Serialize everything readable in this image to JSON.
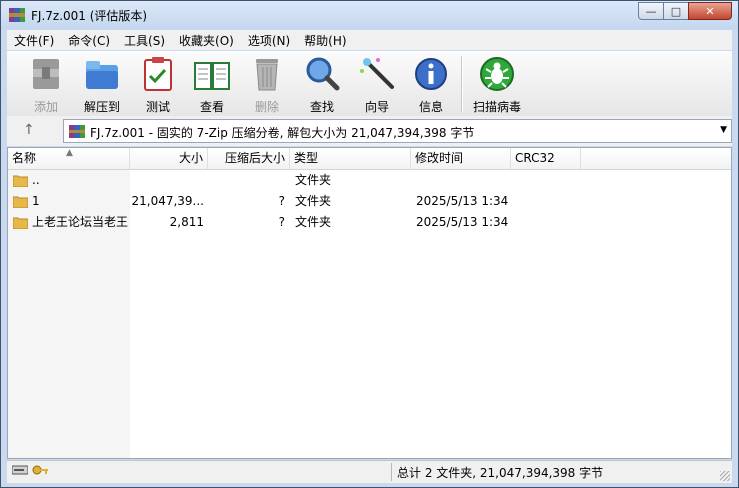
{
  "window": {
    "title": "FJ.7z.001 (评估版本)",
    "min": "0",
    "max": "1",
    "close": "r"
  },
  "menu": [
    "文件(F)",
    "命令(C)",
    "工具(S)",
    "收藏夹(O)",
    "选项(N)",
    "帮助(H)"
  ],
  "toolbar": {
    "add": "添加",
    "extract": "解压到",
    "test": "测试",
    "view": "查看",
    "delete": "删除",
    "find": "查找",
    "wizard": "向导",
    "info": "信息",
    "scan": "扫描病毒"
  },
  "address": {
    "up": "↑",
    "text": "FJ.7z.001 - 固实的 7-Zip 压缩分卷, 解包大小为 21,047,394,398 字节",
    "dropdown": "▼"
  },
  "columns": {
    "name": "名称",
    "size": "大小",
    "packed": "压缩后大小",
    "type": "类型",
    "modified": "修改时间",
    "crc": "CRC32",
    "sort": "▲"
  },
  "rows": [
    {
      "name": "..",
      "size": "",
      "packed": "",
      "type": "文件夹",
      "modified": "",
      "crc": ""
    },
    {
      "name": "1",
      "size": "21,047,39...",
      "packed": "?",
      "type": "文件夹",
      "modified": "2025/5/13 1:34",
      "crc": ""
    },
    {
      "name": "上老王论坛当老王",
      "size": "2,811",
      "packed": "?",
      "type": "文件夹",
      "modified": "2025/5/13 1:34",
      "crc": ""
    }
  ],
  "status": {
    "summary": "总计 2 文件夹, 21,047,394,398 字节"
  },
  "colors": {
    "title_bg": "#c9daf0",
    "folder": "#e8b74a",
    "accent": "#3e7bd1"
  },
  "icons": [
    "app-icon",
    "add-icon",
    "extract-icon",
    "test-icon",
    "view-icon",
    "delete-icon",
    "find-icon",
    "wizard-icon",
    "info-icon",
    "virus-scan-icon",
    "folder-icon",
    "drive-icon",
    "key-icon"
  ]
}
